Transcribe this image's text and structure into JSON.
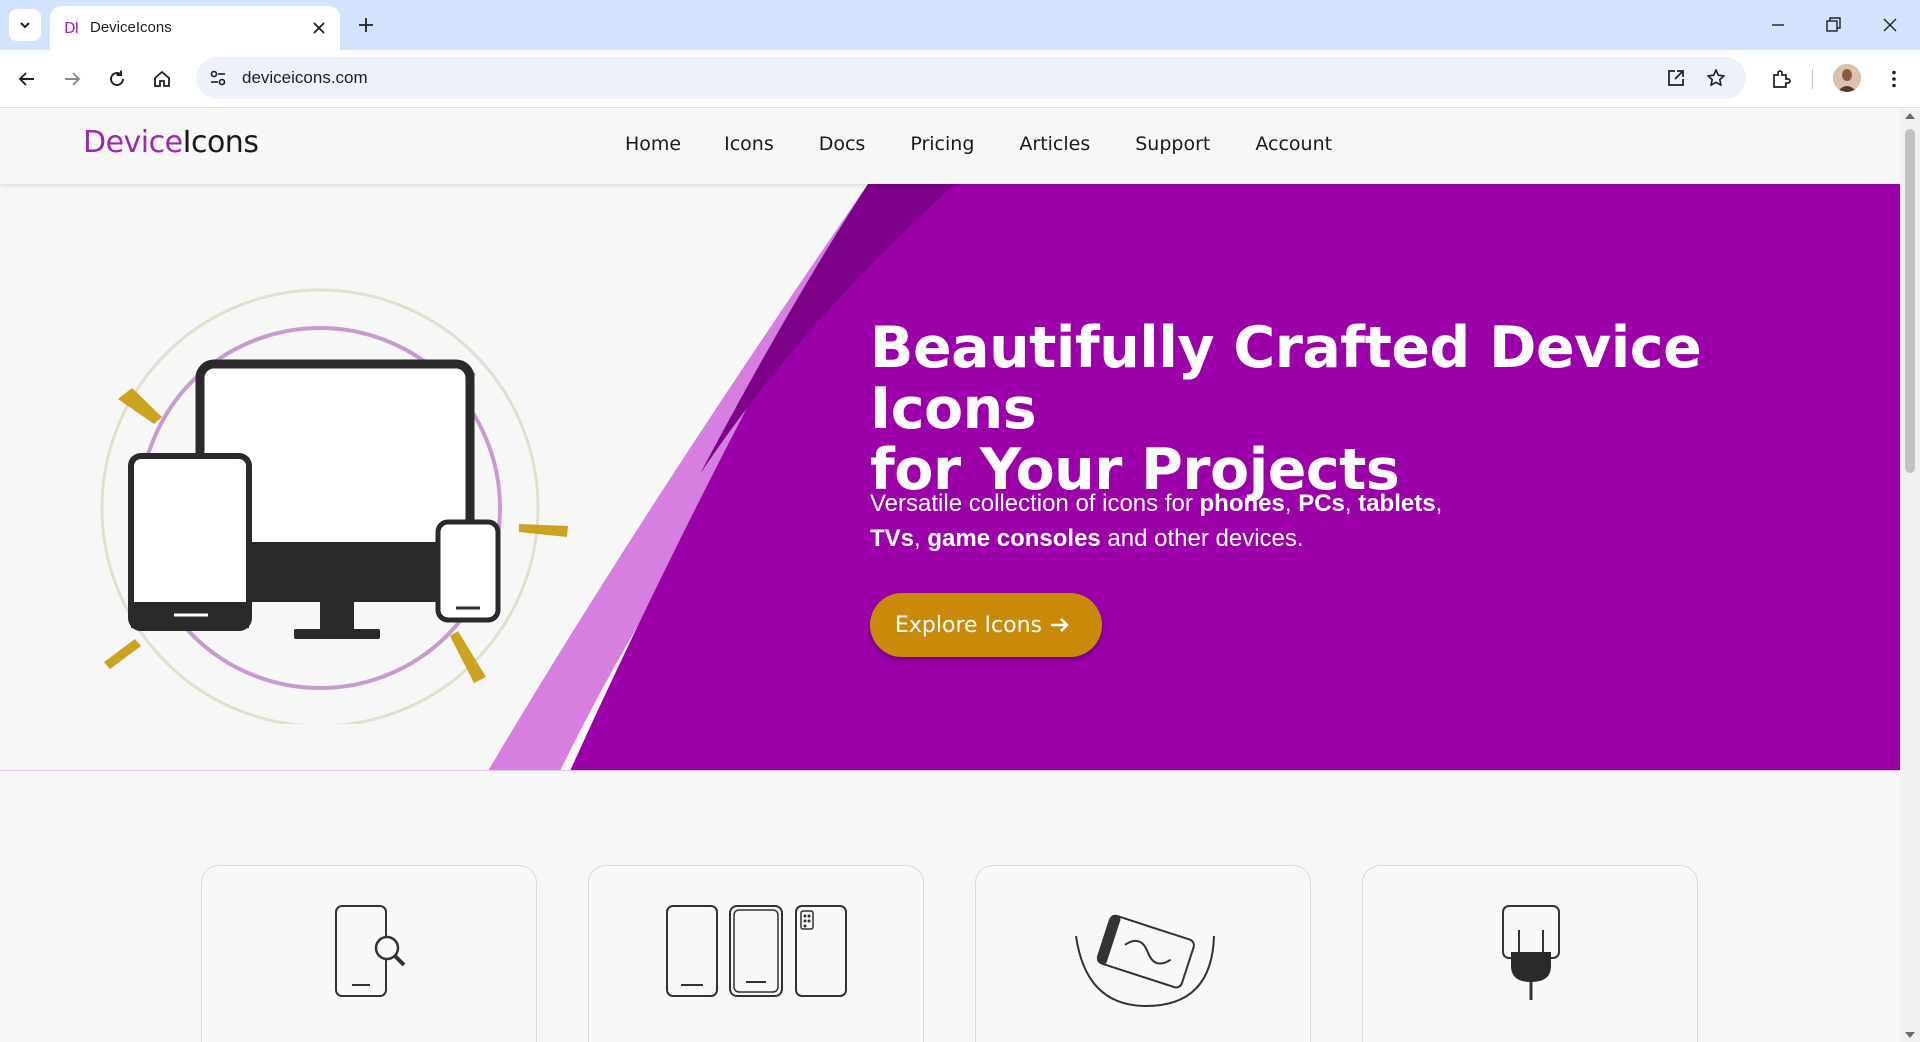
{
  "browser": {
    "tab_favicon": "DI",
    "tab_title": "DeviceIcons",
    "url": "deviceicons.com"
  },
  "site": {
    "logo_part1": "Device",
    "logo_part2": "Icons",
    "nav": [
      "Home",
      "Icons",
      "Docs",
      "Pricing",
      "Articles",
      "Support",
      "Account"
    ]
  },
  "hero": {
    "title_line1": "Beautifully Crafted Device Icons",
    "title_line2": "for Your Projects",
    "sub_prefix": "Versatile collection of icons for ",
    "sub_b1": "phones",
    "sub_sep1": ", ",
    "sub_b2": "PCs",
    "sub_sep2": ", ",
    "sub_b3": "tablets",
    "sub_sep3": ",",
    "sub_b4": "TVs",
    "sub_sep4": ", ",
    "sub_b5": "game consoles",
    "sub_suffix": " and other devices.",
    "cta_label": "Explore Icons"
  },
  "colors": {
    "brand_purple": "#9c00a9",
    "accent_gold": "#c98a0a",
    "chrome_blue": "#d3e3fd"
  },
  "cards": [
    {
      "icon": "phone-search-icon"
    },
    {
      "icon": "phone-sizes-icon"
    },
    {
      "icon": "rotating-phone-icon"
    },
    {
      "icon": "phone-charger-plug-icon"
    }
  ]
}
